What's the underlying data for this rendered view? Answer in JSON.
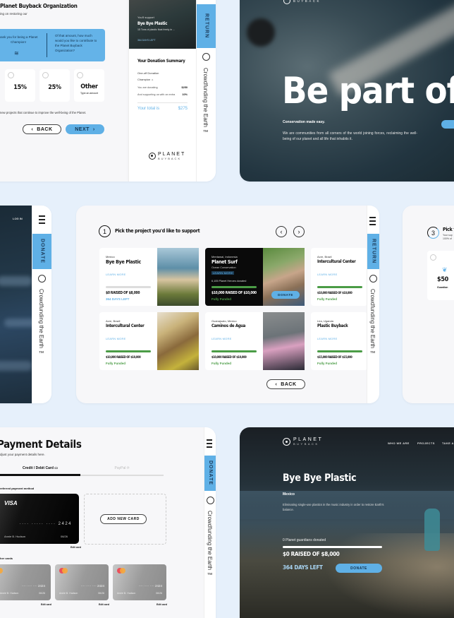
{
  "donate_panel": {
    "title": "Planet Buyback Organization",
    "subtitle": "ing on restoring our",
    "thanks_text": "hank you for being a Planet Champion!",
    "question_text": "Of that amount, how much would you like to contribute to the Planet Buyback Organization?",
    "options": [
      {
        "label": "15%"
      },
      {
        "label": "25%"
      },
      {
        "label": "Other",
        "sub": "Type an amount"
      }
    ],
    "footer_note": "new projects that continue to improve the well-being of the Planet.",
    "back_label": "BACK",
    "next_label": "NEXT"
  },
  "summary_panel": {
    "support_label": "You'll support",
    "project_name": "Bye Bye Plastic",
    "project_desc": "15 Tons of plastic float freely in ...",
    "days_left": "364 DAYS LEFT",
    "summary_title": "Your Donation Summary",
    "donation_type": "One-off Donation",
    "tier": "Champion",
    "rows": [
      {
        "label": "You are donating",
        "value": "$250"
      },
      {
        "label": "And supporting us with an extra",
        "value": "10%"
      }
    ],
    "total_label": "Your total is",
    "total_value": "$275",
    "logo_top": "PLANET",
    "logo_bottom": "BUYBACK",
    "side_tab": "RETURN",
    "side_text": "Crowdfunding the Earth ™"
  },
  "hero_panel": {
    "logo_bottom": "BUYBACK",
    "headline": "Be part of th",
    "tagline": "Conservation made easy.",
    "body": "We are communities from all corners of the world joining forces, reclaiming the well-being of our planet and all life that inhabits it."
  },
  "mobile_panel": {
    "login_label": "LOG IN",
    "side_tab": "DONATE",
    "side_text": "Crowdfunding the Earth ™"
  },
  "projects_panel": {
    "step": "1",
    "title": "Pick the project you'd like to support",
    "side_tab": "RETURN",
    "side_text": "Crowdfunding the Earth ™",
    "back_label": "BACK",
    "projects": [
      {
        "location": "Mexico",
        "name": "Bye Bye Plastic",
        "learn": "LEARN MORE",
        "raised": "$0 RAISED OF $8,000",
        "status": "364 DAYS LEFT",
        "progress": 0
      },
      {
        "location": "Mentawai, Indonesia",
        "name": "Planet Surf",
        "desc": "Ocean Conservation",
        "learn": "LEARN MORE",
        "donors": "6,105 Planet Heroes donated",
        "raised": "$10,000 RAISED OF $10,000",
        "status": "Fully Funded",
        "progress": 100,
        "donate": "DONATE"
      },
      {
        "location": "Acre, Brazil",
        "name": "Intercultural Center",
        "learn": "LEARN MORE",
        "raised": "$10,000 RAISED OF $10,000",
        "status": "Fully Funded",
        "progress": 100
      },
      {
        "location": "Acre, Brazil",
        "name": "Intercultural Center",
        "learn": "LEARN MORE",
        "raised": "$10,000 RAISED OF $10,000",
        "status": "Fully Funded",
        "progress": 100
      },
      {
        "location": "Guanajuato, Mexico",
        "name": "Caminos de Agua",
        "learn": "LEARN MORE",
        "raised": "$10,000 RAISED OF $10,000",
        "status": "Fully Funded",
        "progress": 100
      },
      {
        "location": "Lira, Uganda",
        "name": "Plastic Buyback",
        "learn": "LEARN MORE",
        "raised": "$15,000 RAISED OF $15,000",
        "status": "Fully Funded",
        "progress": 100
      }
    ]
  },
  "tier_panel": {
    "step": "3",
    "title": "Pick t",
    "sub1": "Your sup",
    "sub2": "100% of",
    "amount": "$50",
    "tier": "Guardian"
  },
  "payment_panel": {
    "title": "Payment Details",
    "subtitle": "djust your payment details here.",
    "tab_card": "Credit / Debit Card",
    "tab_paypal": "PayPal",
    "preferred_label": "referred payment method",
    "visa_brand": "VISA",
    "card_number": "···· ····· ···· 2424",
    "card_holder": "Annie B. Hudson",
    "card_exp": "06/26",
    "edit_label": "Edit card",
    "add_card_label": "ADD NEW CARD",
    "other_label": "her cards",
    "other_cards": [
      {
        "number": "···· ····· ···· 2424",
        "holder": "Annie B. Hudson",
        "exp": "06/26"
      },
      {
        "number": "···· ····· ···· 2424",
        "holder": "Annie B. Hudson",
        "exp": "06/26"
      },
      {
        "number": "···· ····· ···· 2424",
        "holder": "Annie B. Hudson",
        "exp": "06/26"
      }
    ],
    "side_tab": "DONATE",
    "side_text": "Crowdfunding the Earth ™"
  },
  "project_detail": {
    "logo_top": "PLANET",
    "logo_bottom": "BUYBACK",
    "nav": [
      "WHO WE ARE",
      "PROJECTS",
      "TAKE AC"
    ],
    "title": "Bye Bye Plastic",
    "location": "Mexico",
    "desc": "Eliminating single-use plastics in the music industry in order to restore Earth's balance.",
    "donors": "0 Planet guardians donated",
    "raised": "$0 RAISED OF $8,000",
    "days_left": "364 DAYS LEFT",
    "donate_label": "DONATE"
  }
}
